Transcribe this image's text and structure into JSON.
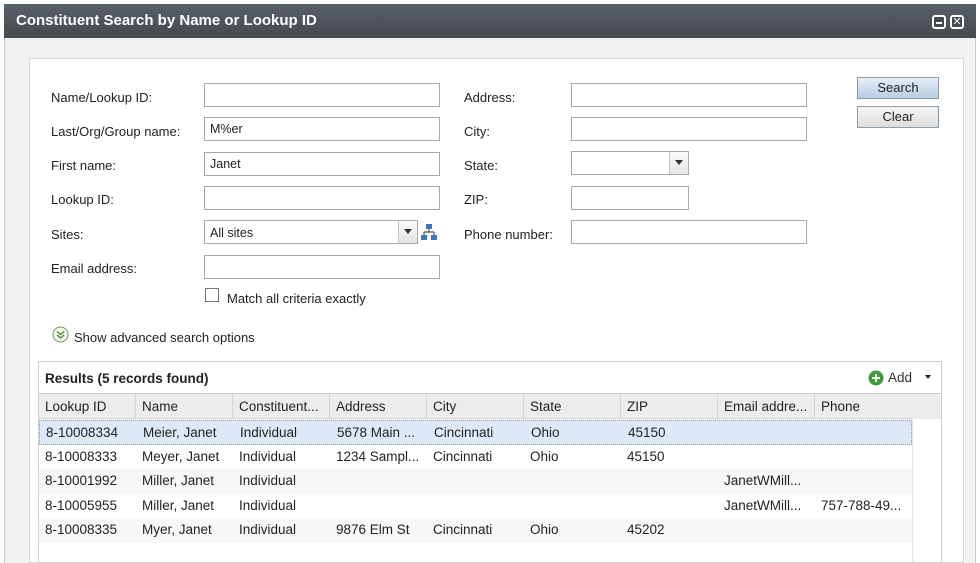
{
  "window": {
    "title": "Constituent Search by Name or Lookup ID"
  },
  "form": {
    "name_lookup_label": "Name/Lookup ID:",
    "name_lookup_value": "",
    "last_name_label": "Last/Org/Group name:",
    "last_name_value": "M%er",
    "first_name_label": "First name:",
    "first_name_value": "Janet",
    "lookup_id_label": "Lookup ID:",
    "lookup_id_value": "",
    "sites_label": "Sites:",
    "sites_value": "All sites",
    "email_label": "Email address:",
    "email_value": "",
    "match_label": "Match all criteria exactly",
    "address_label": "Address:",
    "address_value": "",
    "city_label": "City:",
    "city_value": "",
    "state_label": "State:",
    "state_value": "",
    "zip_label": "ZIP:",
    "zip_value": "",
    "phone_label": "Phone number:",
    "phone_value": "",
    "advanced_label": "Show advanced search options"
  },
  "buttons": {
    "search": "Search",
    "clear": "Clear"
  },
  "results": {
    "title": "Results (5 records found)",
    "add_label": "Add",
    "columns": [
      "Lookup ID",
      "Name",
      "Constituent...",
      "Address",
      "City",
      "State",
      "ZIP",
      "Email addre...",
      "Phone"
    ],
    "rows": [
      [
        "8-10008334",
        "Meier, Janet",
        "Individual",
        "5678 Main ...",
        "Cincinnati",
        "Ohio",
        "45150",
        "",
        ""
      ],
      [
        "8-10008333",
        "Meyer, Janet",
        "Individual",
        "1234 Sampl...",
        "Cincinnati",
        "Ohio",
        "45150",
        "",
        ""
      ],
      [
        "8-10001992",
        "Miller, Janet",
        "Individual",
        "",
        "",
        "",
        "",
        "JanetWMill...",
        ""
      ],
      [
        "8-10005955",
        "Miller, Janet",
        "Individual",
        "",
        "",
        "",
        "",
        "JanetWMill...",
        "757-788-49..."
      ],
      [
        "8-10008335",
        "Myer, Janet",
        "Individual",
        "9876 Elm St",
        "Cincinnati",
        "Ohio",
        "45202",
        "",
        ""
      ]
    ]
  },
  "colors": {
    "titlebar": "#4f545a",
    "search_button": "#c9daec",
    "selected_row": "#dde9f6",
    "add_icon": "#3f9a3a"
  }
}
